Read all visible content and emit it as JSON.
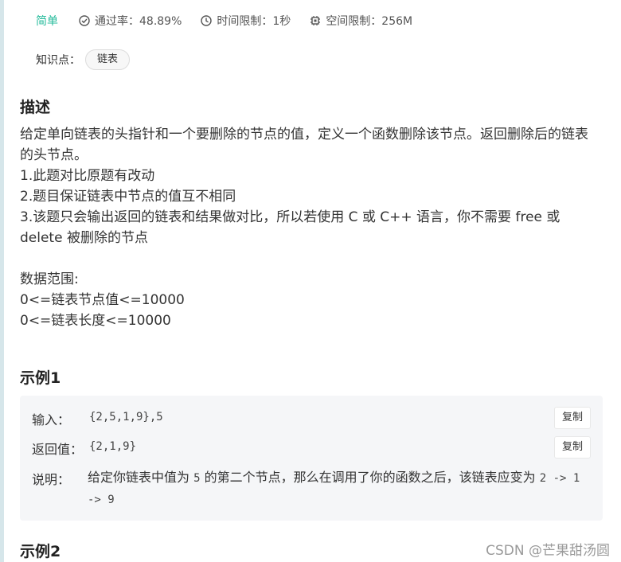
{
  "meta": {
    "difficulty": "简单",
    "pass_rate": "通过率：48.89%",
    "time_limit": "时间限制：1秒",
    "space_limit": "空间限制：256M",
    "icons": [
      "check-circle-icon",
      "clock-icon",
      "chip-icon"
    ]
  },
  "tags": {
    "label": "知识点：",
    "items": [
      "链表"
    ]
  },
  "description": {
    "title": "描述",
    "lines": [
      "给定单向链表的头指针和一个要删除的节点的值，定义一个函数删除该节点。返回删除后的链表的头节点。",
      "1.此题对比原题有改动",
      "2.题目保证链表中节点的值互不相同",
      "3.该题只会输出返回的链表和结果做对比，所以若使用 C 或 C++ 语言，你不需要 free 或 delete 被删除的节点",
      "数据范围:",
      "0<=链表节点值<=10000",
      "0<=链表长度<=10000"
    ]
  },
  "example1": {
    "title": "示例1",
    "input_label": "输入：",
    "input_value": "{2,5,1,9},5",
    "output_label": "返回值：",
    "output_value": "{2,1,9}",
    "explain_label": "说明：",
    "explain_text_1": "给定你链表中值为 ",
    "explain_code_1": "5",
    "explain_text_2": " 的第二个节点，那么在调用了你的函数之后，该链表应变为 ",
    "explain_code_2": "2 -> 1 -> 9",
    "copy_label": "复制"
  },
  "example2": {
    "title": "示例2"
  },
  "watermark": "CSDN @芒果甜汤圆",
  "colors": {
    "difficulty": "#25bb9b",
    "example_bg": "#f5f6f8"
  }
}
